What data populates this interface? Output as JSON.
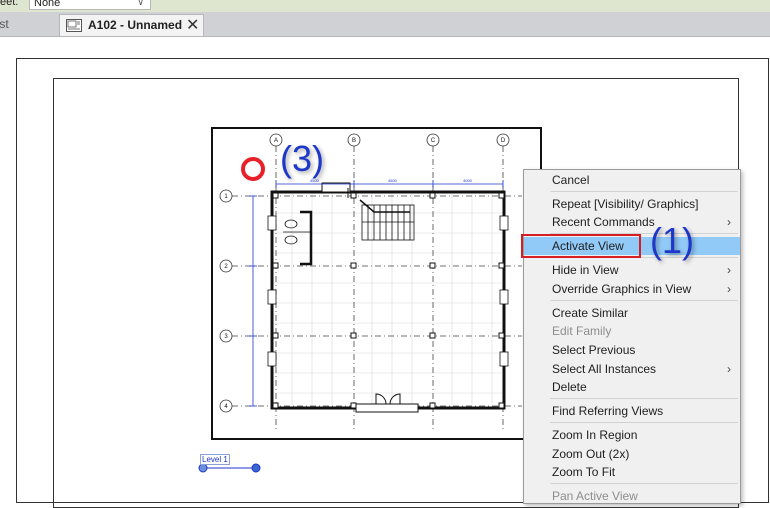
{
  "properties": {
    "label": "eet:",
    "value": "None"
  },
  "tabs": {
    "list_label": "List",
    "active_label": "A102 - Unnamed"
  },
  "annotations": {
    "a1": "(1)",
    "a3": "(3)"
  },
  "grid": {
    "columns": [
      "A",
      "B",
      "C",
      "D"
    ],
    "rows": [
      "1",
      "2",
      "3",
      "4"
    ],
    "dims": [
      "4500",
      "4500",
      "4000"
    ]
  },
  "level": {
    "label": "Level 1"
  },
  "context_menu": {
    "items": [
      {
        "label": "Cancel",
        "disabled": false,
        "submenu": false
      },
      {
        "label": "Repeat [Visibility/ Graphics]",
        "disabled": false,
        "submenu": false
      },
      {
        "label": "Recent Commands",
        "disabled": false,
        "submenu": true
      },
      {
        "label": "Activate View",
        "disabled": false,
        "submenu": false,
        "highlighted": true
      },
      {
        "label": "Hide in View",
        "disabled": false,
        "submenu": true
      },
      {
        "label": "Override Graphics in View",
        "disabled": false,
        "submenu": true
      },
      {
        "label": "Create Similar",
        "disabled": false,
        "submenu": false
      },
      {
        "label": "Edit Family",
        "disabled": true,
        "submenu": false
      },
      {
        "label": "Select Previous",
        "disabled": false,
        "submenu": false
      },
      {
        "label": "Select All Instances",
        "disabled": false,
        "submenu": true
      },
      {
        "label": "Delete",
        "disabled": false,
        "submenu": false
      },
      {
        "label": "Find Referring Views",
        "disabled": false,
        "submenu": false
      },
      {
        "label": "Zoom In Region",
        "disabled": false,
        "submenu": false
      },
      {
        "label": "Zoom Out (2x)",
        "disabled": false,
        "submenu": false
      },
      {
        "label": "Zoom To Fit",
        "disabled": false,
        "submenu": false
      },
      {
        "label": "Pan Active View",
        "disabled": true,
        "submenu": false
      }
    ]
  },
  "colors": {
    "accent_blue": "#1d37c9",
    "highlight": "#91c9f7",
    "red": "#e8202a"
  }
}
